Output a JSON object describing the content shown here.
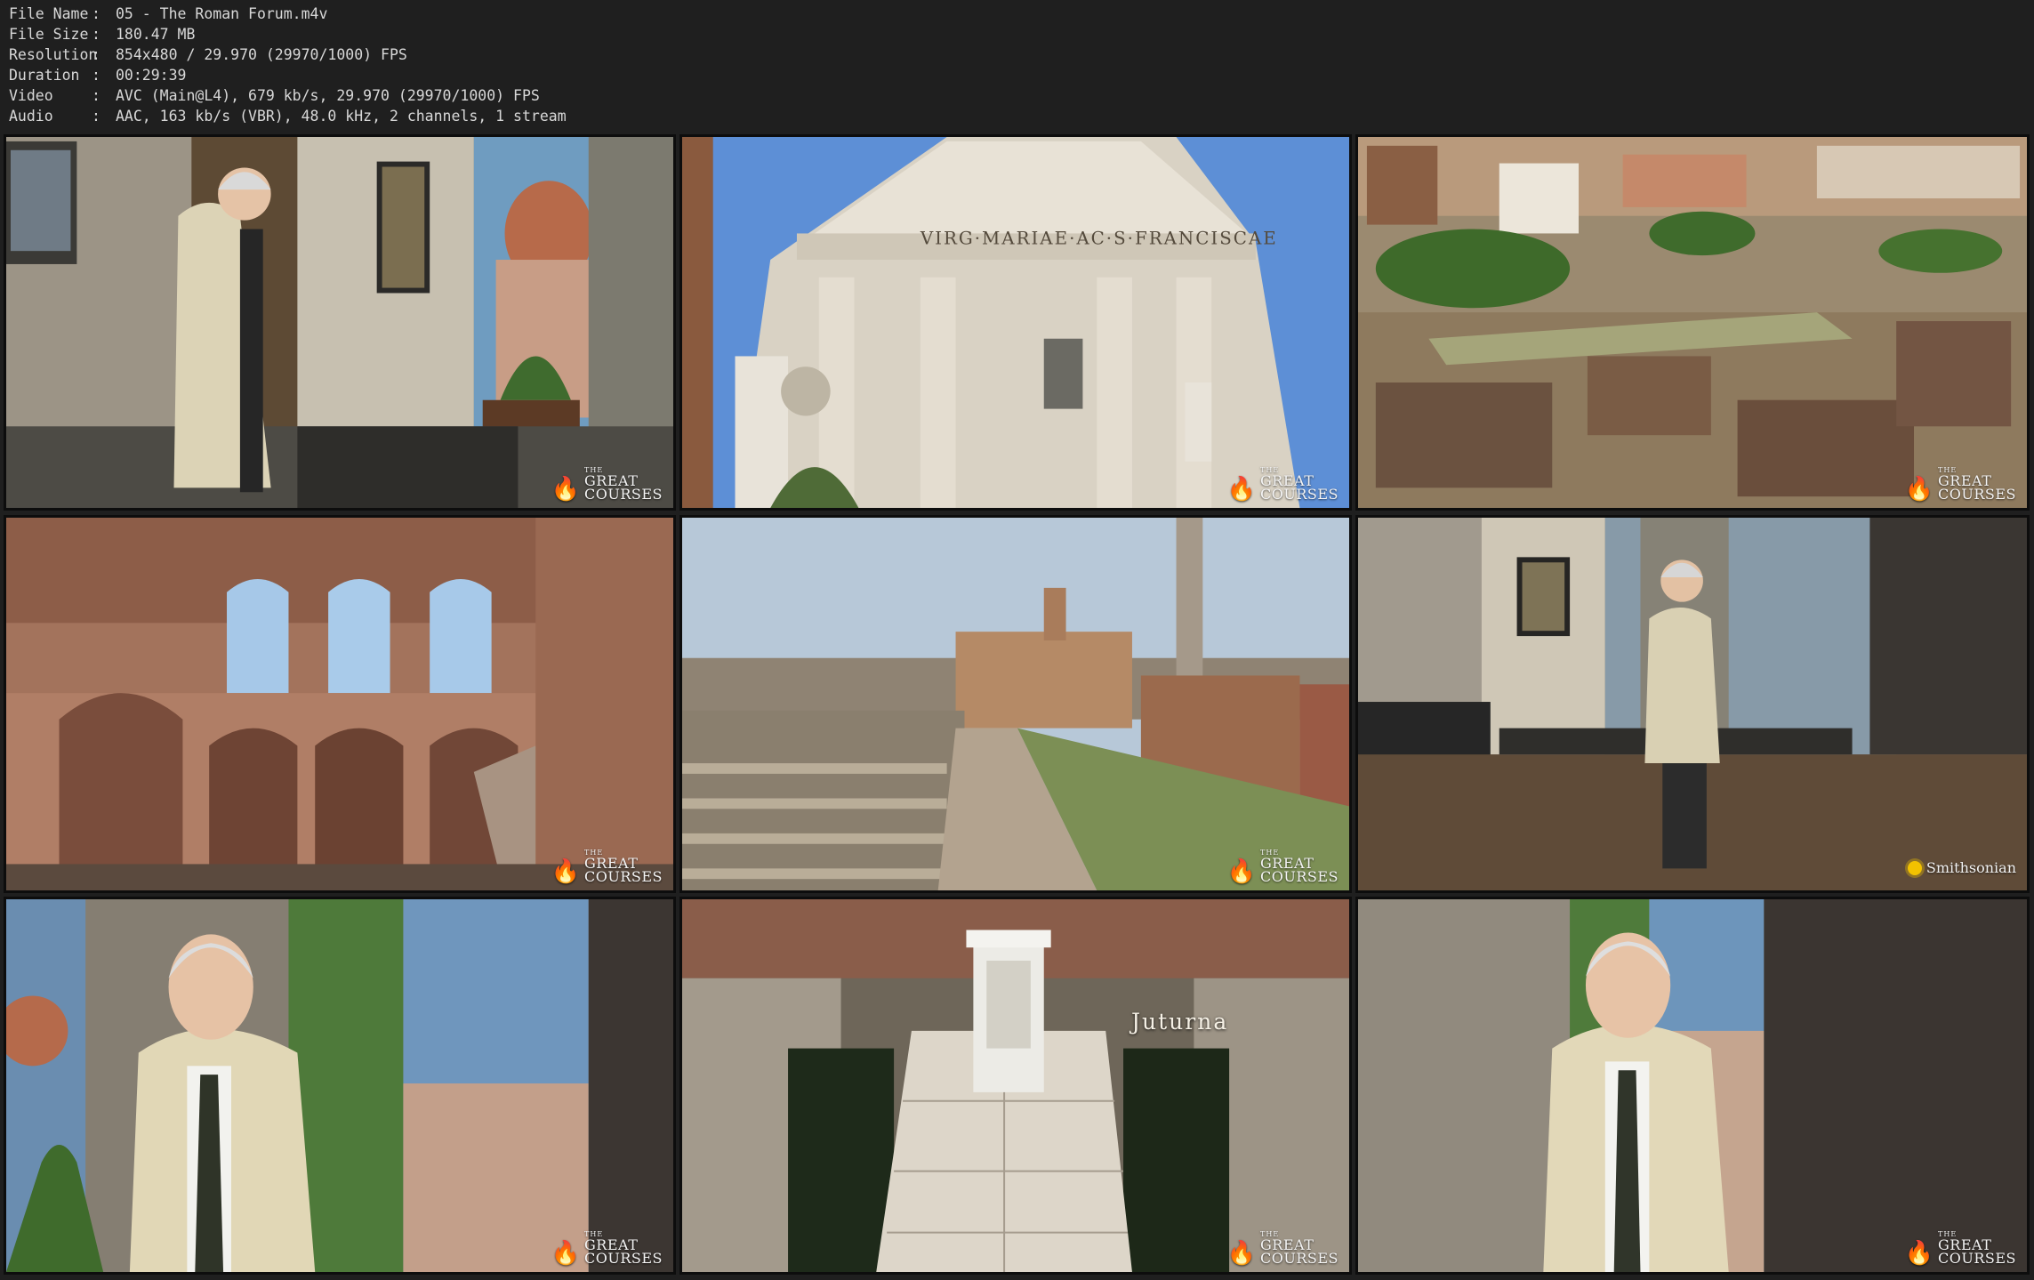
{
  "file_info": [
    {
      "key": "File Name",
      "value": "05 - The Roman Forum.m4v"
    },
    {
      "key": "File Size",
      "value": "180.47 MB"
    },
    {
      "key": "Resolution",
      "value": "854x480 / 29.970 (29970/1000) FPS"
    },
    {
      "key": "Duration",
      "value": "00:29:39"
    },
    {
      "key": "Video",
      "value": "AVC (Main@L4), 679 kb/s, 29.970 (29970/1000) FPS"
    },
    {
      "key": "Audio",
      "value": "AAC, 163 kb/s (VBR), 48.0 kHz, 2 channels, 1 stream"
    }
  ],
  "separator": ":",
  "logo": {
    "the": "THE",
    "line1": "GREAT",
    "line2": "COURSES"
  },
  "smithsonian": "Smithsonian",
  "caption": "Juturna",
  "inscription": "VIRG·MARIAE·AC·S·FRANCISCAE",
  "colors": {
    "background": "#1f1f1f",
    "text": "#d8d8d8",
    "border": "#0d0d0d"
  }
}
